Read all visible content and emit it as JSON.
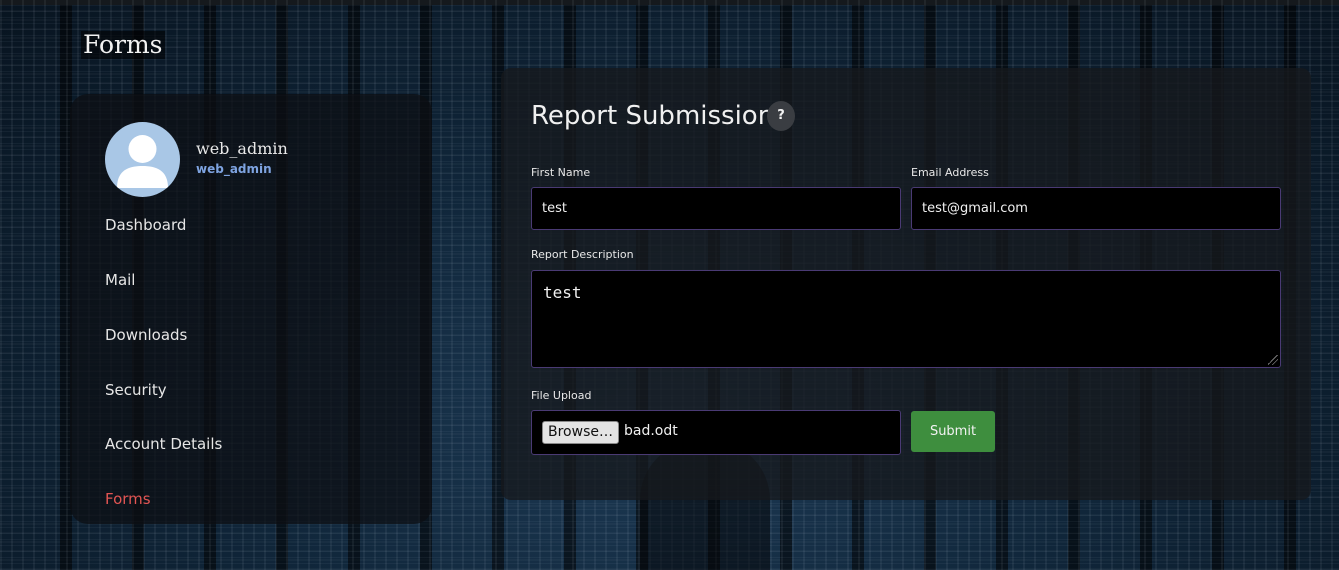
{
  "page": {
    "title": "Forms"
  },
  "profile": {
    "name": "web_admin",
    "role": "web_admin",
    "avatar_icon": "user-avatar-icon"
  },
  "sidebar": {
    "items": [
      {
        "label": "Dashboard",
        "active": false
      },
      {
        "label": "Mail",
        "active": false
      },
      {
        "label": "Downloads",
        "active": false
      },
      {
        "label": "Security",
        "active": false
      },
      {
        "label": "Account Details",
        "active": false
      },
      {
        "label": "Forms",
        "active": true
      }
    ],
    "active_color": "#e25553"
  },
  "form": {
    "title": "Report Submission",
    "help_icon": "?",
    "first_name": {
      "label": "First Name",
      "value": "test"
    },
    "email": {
      "label": "Email Address",
      "value": "test@gmail.com"
    },
    "description": {
      "label": "Report Description",
      "value": "test"
    },
    "file_upload": {
      "label": "File Upload",
      "browse_label": "Browse…",
      "file_name": "bad.odt"
    },
    "submit_label": "Submit",
    "submit_color": "#3e8e3e",
    "field_border_color": "#4a3a74"
  }
}
